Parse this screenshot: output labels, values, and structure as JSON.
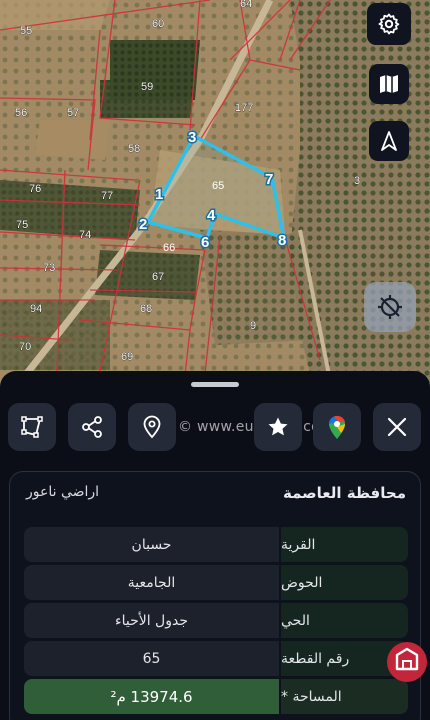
{
  "map": {
    "parcel_labels": [
      "60",
      "64",
      "55",
      "59",
      "56",
      "57",
      "177",
      "58",
      "76",
      "77",
      "3",
      "75",
      "74",
      "73",
      "67",
      "94",
      "68",
      "9",
      "70",
      "69"
    ],
    "vertex_labels": [
      "1",
      "2",
      "3",
      "4",
      "6",
      "7",
      "8"
    ],
    "selected_lot_label": "65",
    "secondary_lot_label": "66",
    "buttons": {
      "settings_icon": "gear-icon",
      "layers_icon": "map-icon",
      "north_icon": "north-arrow-icon",
      "locate_icon": "gps-off-icon"
    }
  },
  "toolbar": {
    "polygon_icon": "polygon-icon",
    "share_icon": "share-icon",
    "location_icon": "location-pin-icon",
    "favorite_icon": "star-icon",
    "google_maps_icon": "google-maps-icon",
    "close_icon": "close-icon"
  },
  "watermark": "© www.eurokajo.com",
  "details": {
    "governorate": "محافظة العاصمة",
    "land_name": "اراضي ناعور",
    "rows": [
      {
        "label": "القرية",
        "value": "حسبان"
      },
      {
        "label": "الحوض",
        "value": "الجامعية"
      },
      {
        "label": "الحي",
        "value": "جدول الأحياء"
      },
      {
        "label": "رقم القطعة",
        "value": "65"
      },
      {
        "label": "المساحة *",
        "value": "13974.6 م²"
      }
    ]
  },
  "colors": {
    "sheet_bg": "#0b0e17",
    "label_bg": "#14261f",
    "value_bg": "#1d212b",
    "area_bg": "#2f5e39",
    "polygon": "#2fc0ea",
    "parcel_lines": "#d0303a"
  }
}
